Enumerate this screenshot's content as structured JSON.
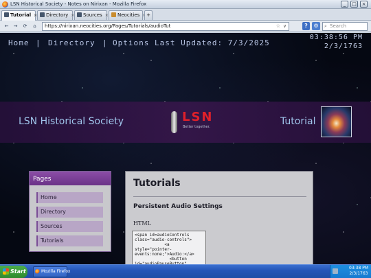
{
  "window": {
    "title": "LSN Historical Society - Notes on Nirixan - Mozilla Firefox",
    "controls": {
      "minimize": "_",
      "maximize": "□",
      "close": "×"
    }
  },
  "tabs": [
    {
      "label": "Tutorial",
      "active": true
    },
    {
      "label": "Directory",
      "active": false
    },
    {
      "label": "Sources",
      "active": false
    },
    {
      "label": "Neocities",
      "active": false
    }
  ],
  "new_tab_label": "+",
  "navbar": {
    "back": "←",
    "forward": "→",
    "reload": "⟳",
    "home": "⌂",
    "url": "https://nirixan.neocities.org/Pages/Tutorials/audioTut",
    "bookmark_star": "☆",
    "url_dropdown": "∨",
    "help": "?",
    "search_placeholder": "Search"
  },
  "site": {
    "nav": {
      "home": "Home",
      "directory": "Directory",
      "options": "Options",
      "separator": "|",
      "last_updated": "Last Updated: 7/3/2025"
    },
    "clock": {
      "time": "03:38:56 PM",
      "date": "2/3/1763"
    },
    "banner": {
      "brand": "LSN Historical Society",
      "page_name": "Tutorial"
    },
    "logo": {
      "word": "LSN",
      "tagline": "Better together."
    },
    "sidebar": {
      "heading": "Pages",
      "items": [
        "Home",
        "Directory",
        "Sources",
        "Tutorials"
      ]
    },
    "content": {
      "title": "Tutorials",
      "section": "Persistent Audio Settings",
      "code_lang": "HTML",
      "code": "<span id=audioControls\nclass=\"audio-controls\">\n            <a\nstyle=\"pointer-\nevents:none;\">Audio:</a>\n              <button\nid=\"audioPauseButton\"\nclass=\"audio-pause-button\""
    }
  },
  "taskbar": {
    "start": "Start",
    "task": "Mozilla Firefox",
    "time": "03:38 PM",
    "date": "2/3/1763"
  },
  "colors": {
    "banner_text": "#9fc4ea",
    "logo_red": "#e0202a",
    "sidebar_header": "#7a3d96",
    "taskbar": "#2556b8"
  }
}
